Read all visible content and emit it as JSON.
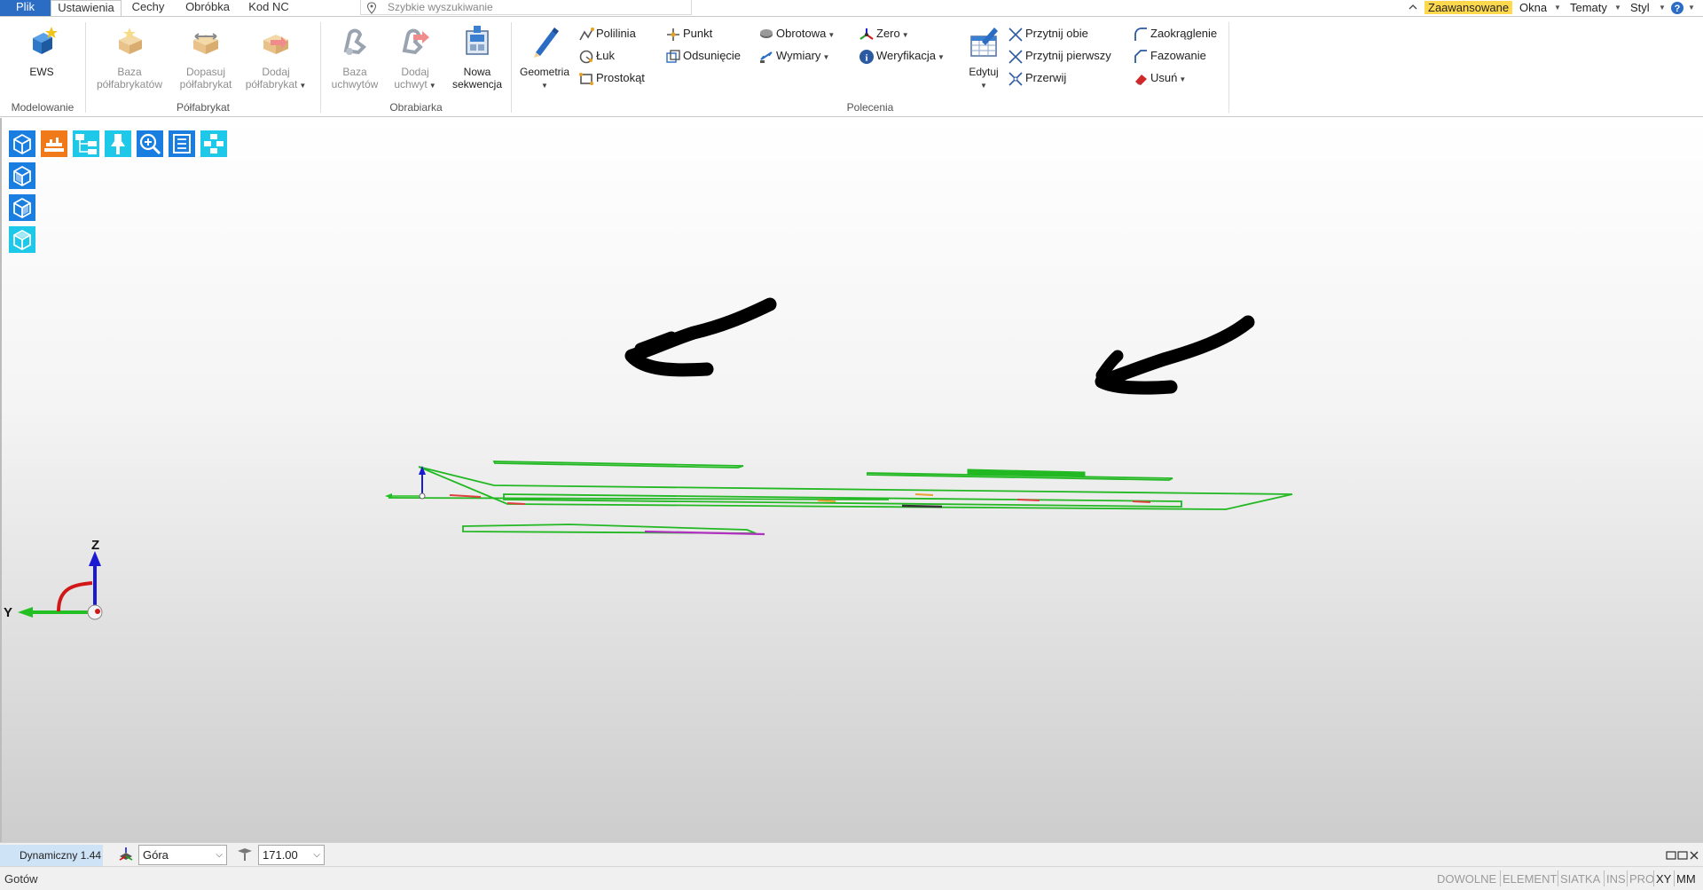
{
  "tabs": {
    "file": "Plik",
    "settings": "Ustawienia",
    "features": "Cechy",
    "machining": "Obróbka",
    "nc_code": "Kod NC"
  },
  "quick_search": {
    "placeholder": "Szybkie wyszukiwanie"
  },
  "right_menu": {
    "advanced": "Zaawansowane",
    "windows": "Okna",
    "themes": "Tematy",
    "style": "Styl"
  },
  "ribbon": {
    "modeling": {
      "label": "Modelowanie",
      "ews": "EWS"
    },
    "stock": {
      "label": "Półfabrykat",
      "stock_base": [
        "Baza",
        "półfabrykatów"
      ],
      "fit_stock": [
        "Dopasuj",
        "półfabrykat"
      ],
      "add_stock": [
        "Dodaj",
        "półfabrykat"
      ]
    },
    "machine": {
      "label": "Obrabiarka",
      "holder_base": [
        "Baza",
        "uchwytów"
      ],
      "add_holder": [
        "Dodaj",
        "uchwyt"
      ],
      "new_sequence": [
        "Nowa",
        "sekwencja"
      ]
    },
    "commands": {
      "label": "Polecenia",
      "geometry": "Geometria",
      "polyline": "Polilinia",
      "arc": "Łuk",
      "rectangle": "Prostokąt",
      "point": "Punkt",
      "offset": "Odsunięcie",
      "rotary": "Obrotowa",
      "dimensions": "Wymiary",
      "zero": "Zero",
      "verification": "Weryfikacja",
      "edit": "Edytuj",
      "trim_both": "Przytnij obie",
      "trim_first": "Przytnij pierwszy",
      "break": "Przerwij",
      "fillet": "Zaokrąglenie",
      "chamfer": "Fazowanie",
      "delete": "Usuń"
    }
  },
  "axes": {
    "z": "Z",
    "y": "Y"
  },
  "view_bar": {
    "mode": "Dynamiczny 1.44",
    "view": "Góra",
    "zoom_value": "171.00"
  },
  "status": {
    "text": "Gotów",
    "flags": [
      "DOWOLNE",
      "ELEMENT",
      "SIATKA",
      "INS",
      "PRO",
      "XY",
      "MM"
    ],
    "active_flags": [
      "XY",
      "MM"
    ]
  },
  "colors": {
    "file_tab": "#2b6cc4",
    "advanced_badge": "#ffd94d",
    "toolbar_blue": "#1a7ee0",
    "toolbar_orange": "#f07a1a",
    "toolbar_cyan": "#1ec8e8",
    "geometry_green": "#22b822",
    "annotation_black": "#000000",
    "axis_blue": "#1a1ad0",
    "axis_red": "#d01818",
    "axis_green": "#22c022"
  }
}
